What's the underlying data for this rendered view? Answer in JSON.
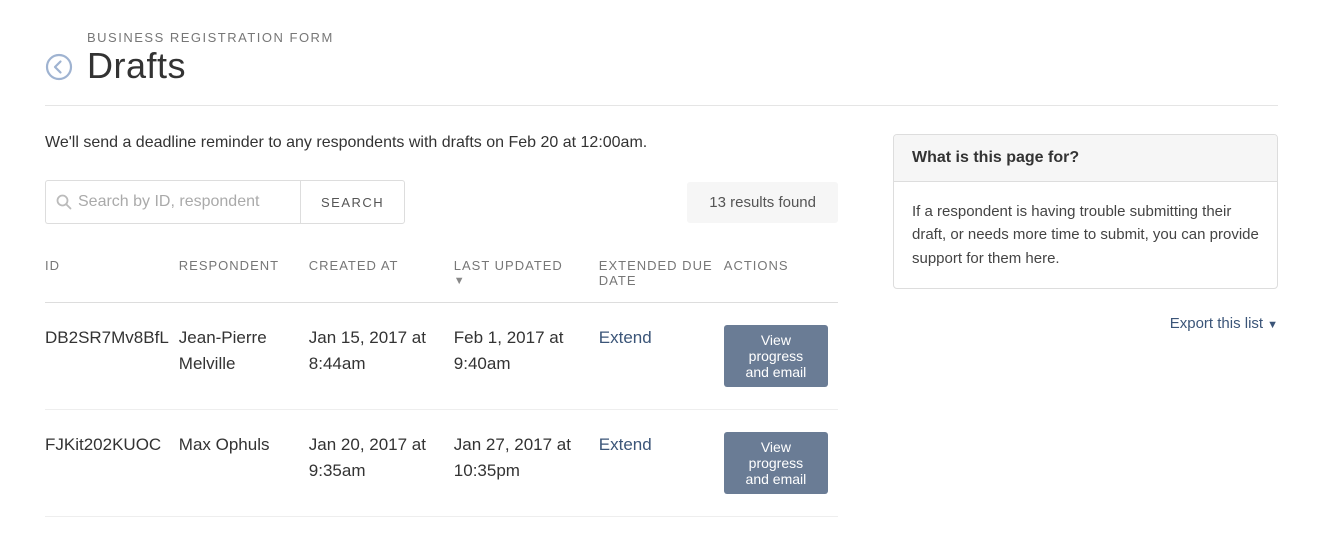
{
  "header": {
    "breadcrumb": "BUSINESS REGISTRATION FORM",
    "title": "Drafts"
  },
  "main": {
    "reminder": "We'll send a deadline reminder to any respondents with drafts on Feb 20 at 12:00am.",
    "search": {
      "placeholder": "Search by ID, respondent",
      "button_label": "SEARCH"
    },
    "results_found": "13 results found",
    "columns": {
      "id": "ID",
      "respondent": "RESPONDENT",
      "created_at": "CREATED AT",
      "last_updated": "LAST UPDATED",
      "extended_due": "EXTENDED DUE DATE",
      "actions": "ACTIONS"
    },
    "rows": [
      {
        "id": "DB2SR7Mv8BfL",
        "respondent": "Jean-Pierre Melville",
        "created_at": "Jan 15, 2017 at 8:44am",
        "last_updated": "Feb 1, 2017 at 9:40am",
        "extend_label": "Extend",
        "action_label": "View progress and email"
      },
      {
        "id": "FJKit202KUOC",
        "respondent": "Max Ophuls",
        "created_at": "Jan 20, 2017 at 9:35am",
        "last_updated": "Jan 27, 2017 at 10:35pm",
        "extend_label": "Extend",
        "action_label": "View progress and email"
      }
    ]
  },
  "aside": {
    "info_title": "What is this page for?",
    "info_body": "If a respondent is having trouble submitting their draft, or needs more time to submit, you can provide support for them here.",
    "export_label": "Export this list"
  }
}
